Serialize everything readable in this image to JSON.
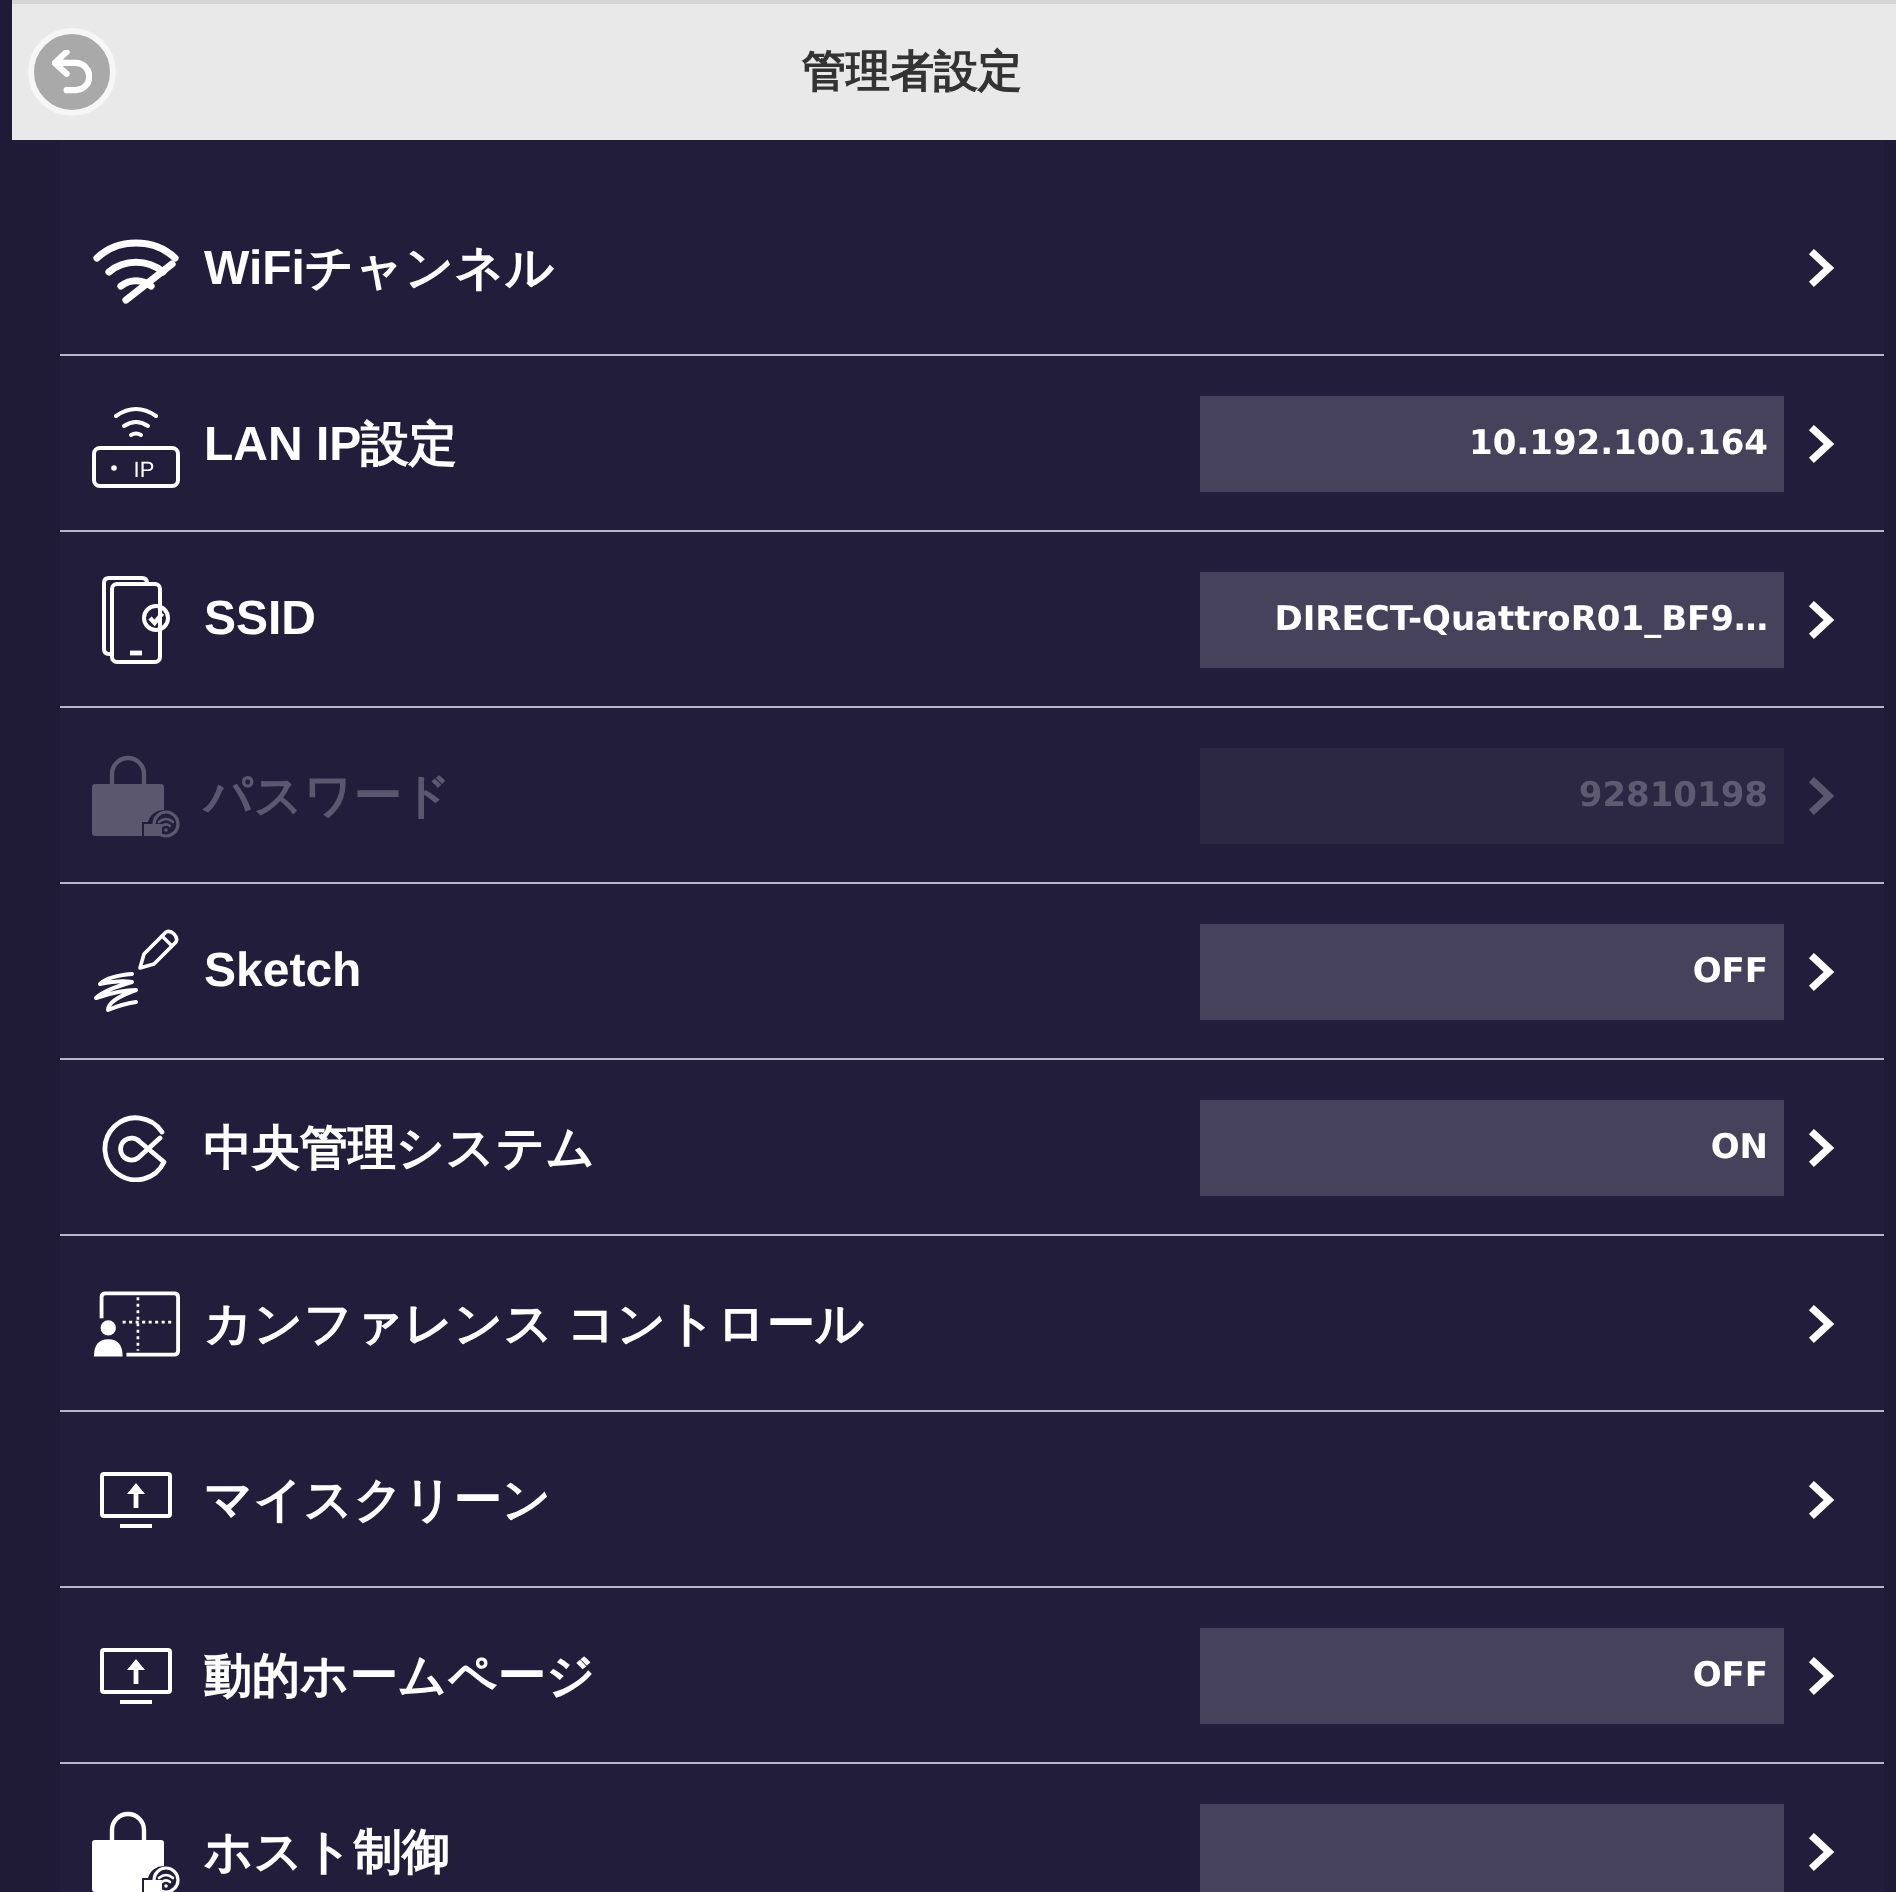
{
  "header": {
    "title": "管理者設定"
  },
  "settings": [
    {
      "kind": "link",
      "label": "WiFiチャンネル",
      "disabled": false
    },
    {
      "kind": "field",
      "label": "LAN IP設定",
      "icon_text": "IP",
      "value": "10.192.100.164",
      "disabled": false
    },
    {
      "kind": "field",
      "label": "SSID",
      "value": "DIRECT-QuattroR01_BF9…",
      "disabled": false
    },
    {
      "kind": "field",
      "label": "パスワード",
      "value": "92810198",
      "disabled": true
    },
    {
      "kind": "field",
      "label": "Sketch",
      "value": "OFF",
      "disabled": false
    },
    {
      "kind": "field",
      "label": "中央管理システム",
      "value": "ON",
      "disabled": false
    },
    {
      "kind": "link",
      "label": "カンファレンス コントロール",
      "disabled": false
    },
    {
      "kind": "link",
      "label": "マイスクリーン",
      "disabled": false
    },
    {
      "kind": "field",
      "label": "動的ホームページ",
      "value": "OFF",
      "disabled": false
    },
    {
      "kind": "field",
      "label": "ホスト制御",
      "disabled": false
    }
  ]
}
